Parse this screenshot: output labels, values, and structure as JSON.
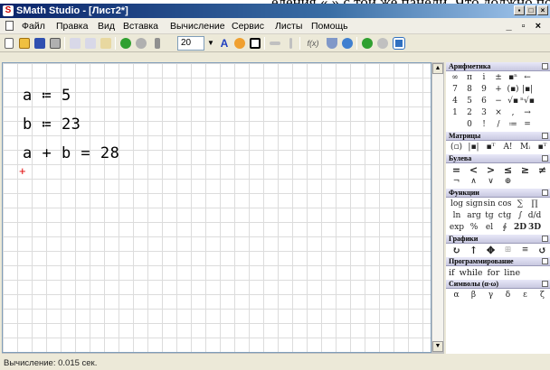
{
  "doc_strip": "еления « » с той же панели. Что должно пол",
  "window": {
    "title": "SMath Studio - [Лист2*]",
    "title_buttons": [
      "▪",
      "□",
      "×"
    ]
  },
  "menu": {
    "items": [
      "Файл",
      "Правка",
      "Вид",
      "Вставка",
      "Вычисление",
      "Сервис",
      "Листы",
      "Помощь"
    ],
    "right_controls": "_ ▫ ×"
  },
  "toolbar": {
    "font_size": "20",
    "text_tool": "A",
    "function_label": "f(x)"
  },
  "worksheet": {
    "expressions": [
      "a ≔ 5",
      "b ≔ 23",
      "a + b = 28"
    ],
    "cursor_symbol": "+"
  },
  "panel": {
    "sections": [
      {
        "title": "Арифметика",
        "rows": [
          [
            "∞",
            "π",
            "i",
            "±",
            "▪ⁿ",
            "←"
          ],
          [
            "7",
            "8",
            "9",
            "+",
            "(▪)",
            "|▪|"
          ],
          [
            "4",
            "5",
            "6",
            "−",
            "√▪",
            "ⁿ√▪"
          ],
          [
            "1",
            "2",
            "3",
            "×",
            ",",
            "→"
          ],
          [
            "",
            "0",
            "!",
            "/",
            "≔",
            "="
          ]
        ]
      },
      {
        "title": "Матрицы",
        "rows": [
          [
            "(▫)",
            "|▪|",
            "▪ᵀ",
            "A!",
            "Mᵢ",
            "▪ᵀ"
          ]
        ]
      },
      {
        "title": "Булева",
        "rows": [
          [
            "=",
            "<",
            ">",
            "≤",
            "≥",
            "≠"
          ],
          [
            "¬",
            "∧",
            "∨",
            "⊕",
            "",
            ""
          ]
        ]
      },
      {
        "title": "Функции",
        "rows": [
          [
            "log",
            "sign",
            "sin",
            "cos",
            "∑",
            "∏"
          ],
          [
            "ln",
            "arg",
            "tg",
            "ctg",
            "∫",
            "d/d"
          ],
          [
            "exp",
            "%",
            "el",
            "∮",
            "2D",
            "3D"
          ]
        ]
      },
      {
        "title": "Графики",
        "rows": [
          [
            "↻",
            "↑",
            "✥",
            "⊞",
            "≡",
            "↺"
          ]
        ]
      },
      {
        "title": "Программирование",
        "rows": [
          [
            "if",
            "while",
            "for",
            "line"
          ]
        ]
      },
      {
        "title": "Символы (α-ω)",
        "rows": [
          [
            "α",
            "β",
            "γ",
            "δ",
            "ε",
            "ζ"
          ]
        ]
      }
    ]
  },
  "status": {
    "text": "Вычисление: 0.015 сек."
  }
}
